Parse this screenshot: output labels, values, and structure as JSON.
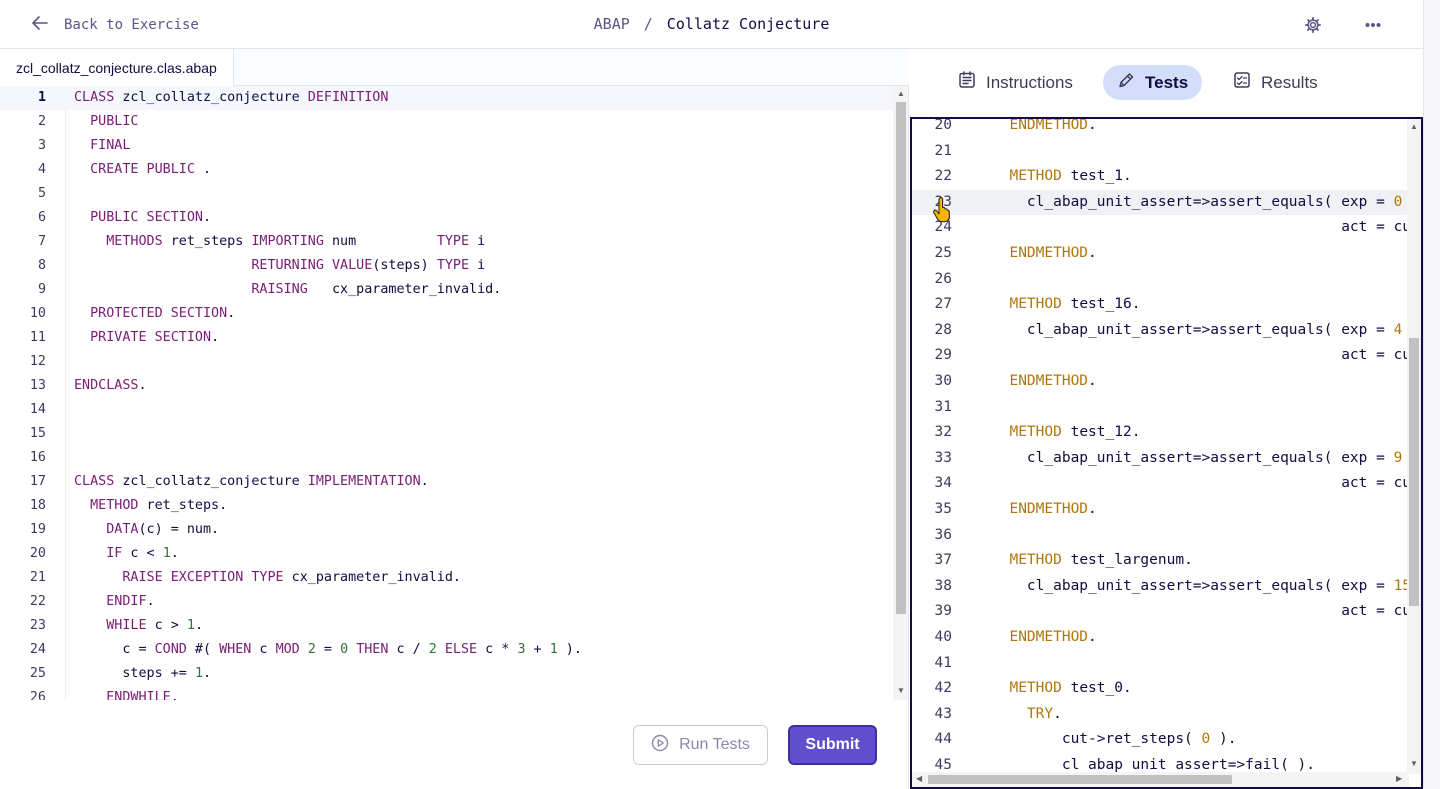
{
  "header": {
    "back_label": "Back to Exercise",
    "language": "ABAP",
    "separator": "/",
    "exercise_title": "Collatz Conjecture"
  },
  "file_tab": {
    "name": "zcl_collatz_conjecture.clas.abap"
  },
  "editor": {
    "active_line": 1,
    "lines": [
      [
        [
          "kw",
          "CLASS"
        ],
        [
          "t",
          " zcl_collatz_conjecture "
        ],
        [
          "kw",
          "DEFINITION"
        ]
      ],
      [
        [
          "t",
          "  "
        ],
        [
          "kw",
          "PUBLIC"
        ]
      ],
      [
        [
          "t",
          "  "
        ],
        [
          "kw",
          "FINAL"
        ]
      ],
      [
        [
          "t",
          "  "
        ],
        [
          "kw",
          "CREATE PUBLIC"
        ],
        [
          "t",
          " ."
        ]
      ],
      [],
      [
        [
          "t",
          "  "
        ],
        [
          "kw",
          "PUBLIC SECTION"
        ],
        [
          "t",
          "."
        ]
      ],
      [
        [
          "t",
          "    "
        ],
        [
          "kw",
          "METHODS"
        ],
        [
          "t",
          " ret_steps "
        ],
        [
          "kw",
          "IMPORTING"
        ],
        [
          "t",
          " num          "
        ],
        [
          "kw",
          "TYPE"
        ],
        [
          "t",
          " i"
        ]
      ],
      [
        [
          "t",
          "                      "
        ],
        [
          "kw",
          "RETURNING VALUE"
        ],
        [
          "t",
          "(steps) "
        ],
        [
          "kw",
          "TYPE"
        ],
        [
          "t",
          " i"
        ]
      ],
      [
        [
          "t",
          "                      "
        ],
        [
          "kw",
          "RAISING"
        ],
        [
          "t",
          "   cx_parameter_invalid."
        ]
      ],
      [
        [
          "t",
          "  "
        ],
        [
          "kw",
          "PROTECTED SECTION"
        ],
        [
          "t",
          "."
        ]
      ],
      [
        [
          "t",
          "  "
        ],
        [
          "kw",
          "PRIVATE SECTION"
        ],
        [
          "t",
          "."
        ]
      ],
      [],
      [
        [
          "kw",
          "ENDCLASS"
        ],
        [
          "t",
          "."
        ]
      ],
      [],
      [],
      [],
      [
        [
          "kw",
          "CLASS"
        ],
        [
          "t",
          " zcl_collatz_conjecture "
        ],
        [
          "kw",
          "IMPLEMENTATION"
        ],
        [
          "t",
          "."
        ]
      ],
      [
        [
          "t",
          "  "
        ],
        [
          "kw",
          "METHOD"
        ],
        [
          "t",
          " ret_steps."
        ]
      ],
      [
        [
          "t",
          "    "
        ],
        [
          "kw",
          "DATA"
        ],
        [
          "t",
          "(c) = num."
        ]
      ],
      [
        [
          "t",
          "    "
        ],
        [
          "kw",
          "IF"
        ],
        [
          "t",
          " c < "
        ],
        [
          "num",
          "1"
        ],
        [
          "t",
          "."
        ]
      ],
      [
        [
          "t",
          "      "
        ],
        [
          "kw",
          "RAISE EXCEPTION TYPE"
        ],
        [
          "t",
          " cx_parameter_invalid."
        ]
      ],
      [
        [
          "t",
          "    "
        ],
        [
          "kw",
          "ENDIF"
        ],
        [
          "t",
          "."
        ]
      ],
      [
        [
          "t",
          "    "
        ],
        [
          "kw",
          "WHILE"
        ],
        [
          "t",
          " c > "
        ],
        [
          "num",
          "1"
        ],
        [
          "t",
          "."
        ]
      ],
      [
        [
          "t",
          "      c = "
        ],
        [
          "kw",
          "COND"
        ],
        [
          "t",
          " #( "
        ],
        [
          "kw",
          "WHEN"
        ],
        [
          "t",
          " c "
        ],
        [
          "kw",
          "MOD"
        ],
        [
          "t",
          " "
        ],
        [
          "num",
          "2"
        ],
        [
          "t",
          " = "
        ],
        [
          "num",
          "0"
        ],
        [
          "t",
          " "
        ],
        [
          "kw",
          "THEN"
        ],
        [
          "t",
          " c / "
        ],
        [
          "num",
          "2"
        ],
        [
          "t",
          " "
        ],
        [
          "kw",
          "ELSE"
        ],
        [
          "t",
          " c * "
        ],
        [
          "num",
          "3"
        ],
        [
          "t",
          " + "
        ],
        [
          "num",
          "1"
        ],
        [
          "t",
          " )."
        ]
      ],
      [
        [
          "t",
          "      steps += "
        ],
        [
          "num",
          "1"
        ],
        [
          "t",
          "."
        ]
      ],
      [
        [
          "t",
          "    "
        ],
        [
          "kw",
          "ENDWHILE"
        ],
        [
          "t",
          "."
        ]
      ]
    ]
  },
  "actions": {
    "run_tests_label": "Run Tests",
    "submit_label": "Submit"
  },
  "right_tabs": [
    {
      "label": "Instructions",
      "icon": "instructions-icon",
      "active": false
    },
    {
      "label": "Tests",
      "icon": "tests-icon",
      "active": true
    },
    {
      "label": "Results",
      "icon": "results-icon",
      "active": false
    }
  ],
  "tests": {
    "first_line": 20,
    "active_line": 23,
    "lines": [
      [
        [
          "t",
          "  "
        ],
        [
          "kw",
          "ENDMETHOD"
        ],
        [
          "t",
          "."
        ]
      ],
      [],
      [
        [
          "t",
          "  "
        ],
        [
          "kw",
          "METHOD"
        ],
        [
          "t",
          " test_1."
        ]
      ],
      [
        [
          "t",
          "    cl_abap_unit_assert=>assert_equals( exp = "
        ],
        [
          "num",
          "0"
        ]
      ],
      [
        [
          "t",
          "                                        act = cu"
        ]
      ],
      [
        [
          "t",
          "  "
        ],
        [
          "kw",
          "ENDMETHOD"
        ],
        [
          "t",
          "."
        ]
      ],
      [],
      [
        [
          "t",
          "  "
        ],
        [
          "kw",
          "METHOD"
        ],
        [
          "t",
          " test_16."
        ]
      ],
      [
        [
          "t",
          "    cl_abap_unit_assert=>assert_equals( exp = "
        ],
        [
          "num",
          "4"
        ]
      ],
      [
        [
          "t",
          "                                        act = cu"
        ]
      ],
      [
        [
          "t",
          "  "
        ],
        [
          "kw",
          "ENDMETHOD"
        ],
        [
          "t",
          "."
        ]
      ],
      [],
      [
        [
          "t",
          "  "
        ],
        [
          "kw",
          "METHOD"
        ],
        [
          "t",
          " test_12."
        ]
      ],
      [
        [
          "t",
          "    cl_abap_unit_assert=>assert_equals( exp = "
        ],
        [
          "num",
          "9"
        ]
      ],
      [
        [
          "t",
          "                                        act = cu"
        ]
      ],
      [
        [
          "t",
          "  "
        ],
        [
          "kw",
          "ENDMETHOD"
        ],
        [
          "t",
          "."
        ]
      ],
      [],
      [
        [
          "t",
          "  "
        ],
        [
          "kw",
          "METHOD"
        ],
        [
          "t",
          " test_largenum."
        ]
      ],
      [
        [
          "t",
          "    cl_abap_unit_assert=>assert_equals( exp = "
        ],
        [
          "num",
          "15"
        ]
      ],
      [
        [
          "t",
          "                                        act = cu"
        ]
      ],
      [
        [
          "t",
          "  "
        ],
        [
          "kw",
          "ENDMETHOD"
        ],
        [
          "t",
          "."
        ]
      ],
      [],
      [
        [
          "t",
          "  "
        ],
        [
          "kw",
          "METHOD"
        ],
        [
          "t",
          " test_0."
        ]
      ],
      [
        [
          "t",
          "    "
        ],
        [
          "kw",
          "TRY"
        ],
        [
          "t",
          "."
        ]
      ],
      [
        [
          "t",
          "        cut->ret_steps( "
        ],
        [
          "num",
          "0"
        ],
        [
          "t",
          " )."
        ]
      ],
      [
        [
          "t",
          "        cl_abap_unit_assert=>fail( )."
        ]
      ]
    ]
  },
  "colors": {
    "keyword_left": "#7a1d75",
    "number_left": "#38713a",
    "keyword_right": "#b0780a",
    "submit_bg": "#604fcd",
    "active_tab_bg": "#d3dffa"
  }
}
